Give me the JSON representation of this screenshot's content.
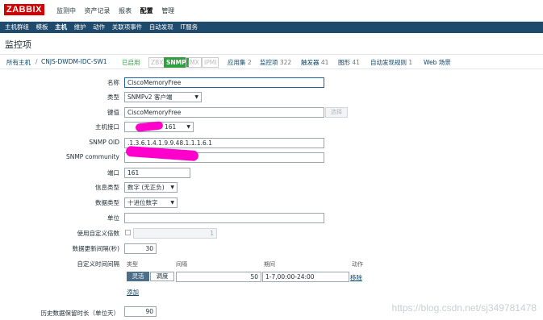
{
  "app": {
    "logo": "ZABBIX"
  },
  "topmenu": {
    "items": [
      "监测中",
      "资产记录",
      "报表",
      "配置",
      "管理"
    ],
    "active_index": 3
  },
  "submenu": {
    "items": [
      "主机群组",
      "模板",
      "主机",
      "维护",
      "动作",
      "关联项事件",
      "自动发现",
      "IT服务"
    ],
    "active_index": 2
  },
  "page": {
    "title": "监控项"
  },
  "breadcrumb": {
    "all_hosts": "所有主机",
    "separator": "/",
    "host": "CNJS-DWDM-IDC-SW1",
    "enabled": "已启用",
    "tags": [
      "ZBX",
      "SNMP",
      "JMX",
      "IPMI"
    ],
    "tabs": [
      {
        "label": "应用集",
        "count": "2"
      },
      {
        "label": "监控项",
        "count": "322"
      },
      {
        "label": "触发器",
        "count": "41"
      },
      {
        "label": "图形",
        "count": "41"
      },
      {
        "label": "自动发现规则",
        "count": "1"
      },
      {
        "label": "Web 场景",
        "count": ""
      }
    ]
  },
  "form": {
    "name": {
      "label": "名称",
      "value": "CiscoMemoryFree"
    },
    "type": {
      "label": "类型",
      "value": "SNMPv2 客户端"
    },
    "key": {
      "label": "键值",
      "value": "CiscoMemoryFree",
      "select_button": "选择"
    },
    "interface": {
      "label": "主机接口",
      "value_suffix": "161"
    },
    "snmp_oid": {
      "label": "SNMP OID",
      "value": ".1.3.6.1.4.1.9.9.48.1.1.1.6.1"
    },
    "snmp_community": {
      "label": "SNMP community",
      "value": ""
    },
    "port": {
      "label": "端口",
      "value": "161"
    },
    "value_type": {
      "label": "信息类型",
      "value": "数字 (无正负)"
    },
    "data_type": {
      "label": "数据类型",
      "value": "十进位数字"
    },
    "units": {
      "label": "单位",
      "value": ""
    },
    "multiplier": {
      "label": "使用自定义倍数",
      "value": "1",
      "checked": false
    },
    "interval": {
      "label": "数据更新间隔(秒)",
      "value": "30"
    },
    "custom_intervals": {
      "label": "自定义时间间隔",
      "headers": [
        "类型",
        "间隔",
        "期间",
        "动作"
      ],
      "row": {
        "toggle_a": "灵活",
        "toggle_b": "调度",
        "interval": "50",
        "period": "1-7,00:00-24:00",
        "remove": "移除"
      },
      "add_link": "添加"
    },
    "history": {
      "label": "历史数据保留时长（单位天）",
      "value": "90"
    }
  },
  "watermark": "https://blog.csdn.net/sj349781478",
  "colors": {
    "logo_red": "#d40000",
    "submenu_bg": "#1f4a6c",
    "snmp_green": "#2f9f3f",
    "redaction_pink": "#ff00cc"
  }
}
